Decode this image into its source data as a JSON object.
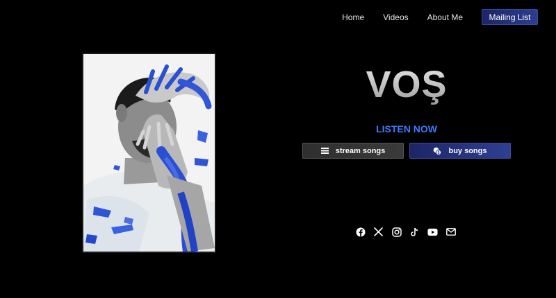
{
  "nav": {
    "home": "Home",
    "videos": "Videos",
    "about": "About Me",
    "mailing_list": "Mailing List"
  },
  "hero": {
    "logo": "VOŞ",
    "listen_now": "LISTEN NOW"
  },
  "buttons": {
    "stream": {
      "label": "stream songs",
      "icon": "list-icon"
    },
    "buy": {
      "label": "buy songs",
      "icon": "coins-icon"
    }
  },
  "social": [
    "facebook-icon",
    "x-icon",
    "instagram-icon",
    "tiktok-icon",
    "youtube-icon",
    "mail-icon"
  ],
  "colors": {
    "accent_blue": "#3a7bff",
    "button_navy": "#243280",
    "background": "#000000"
  }
}
